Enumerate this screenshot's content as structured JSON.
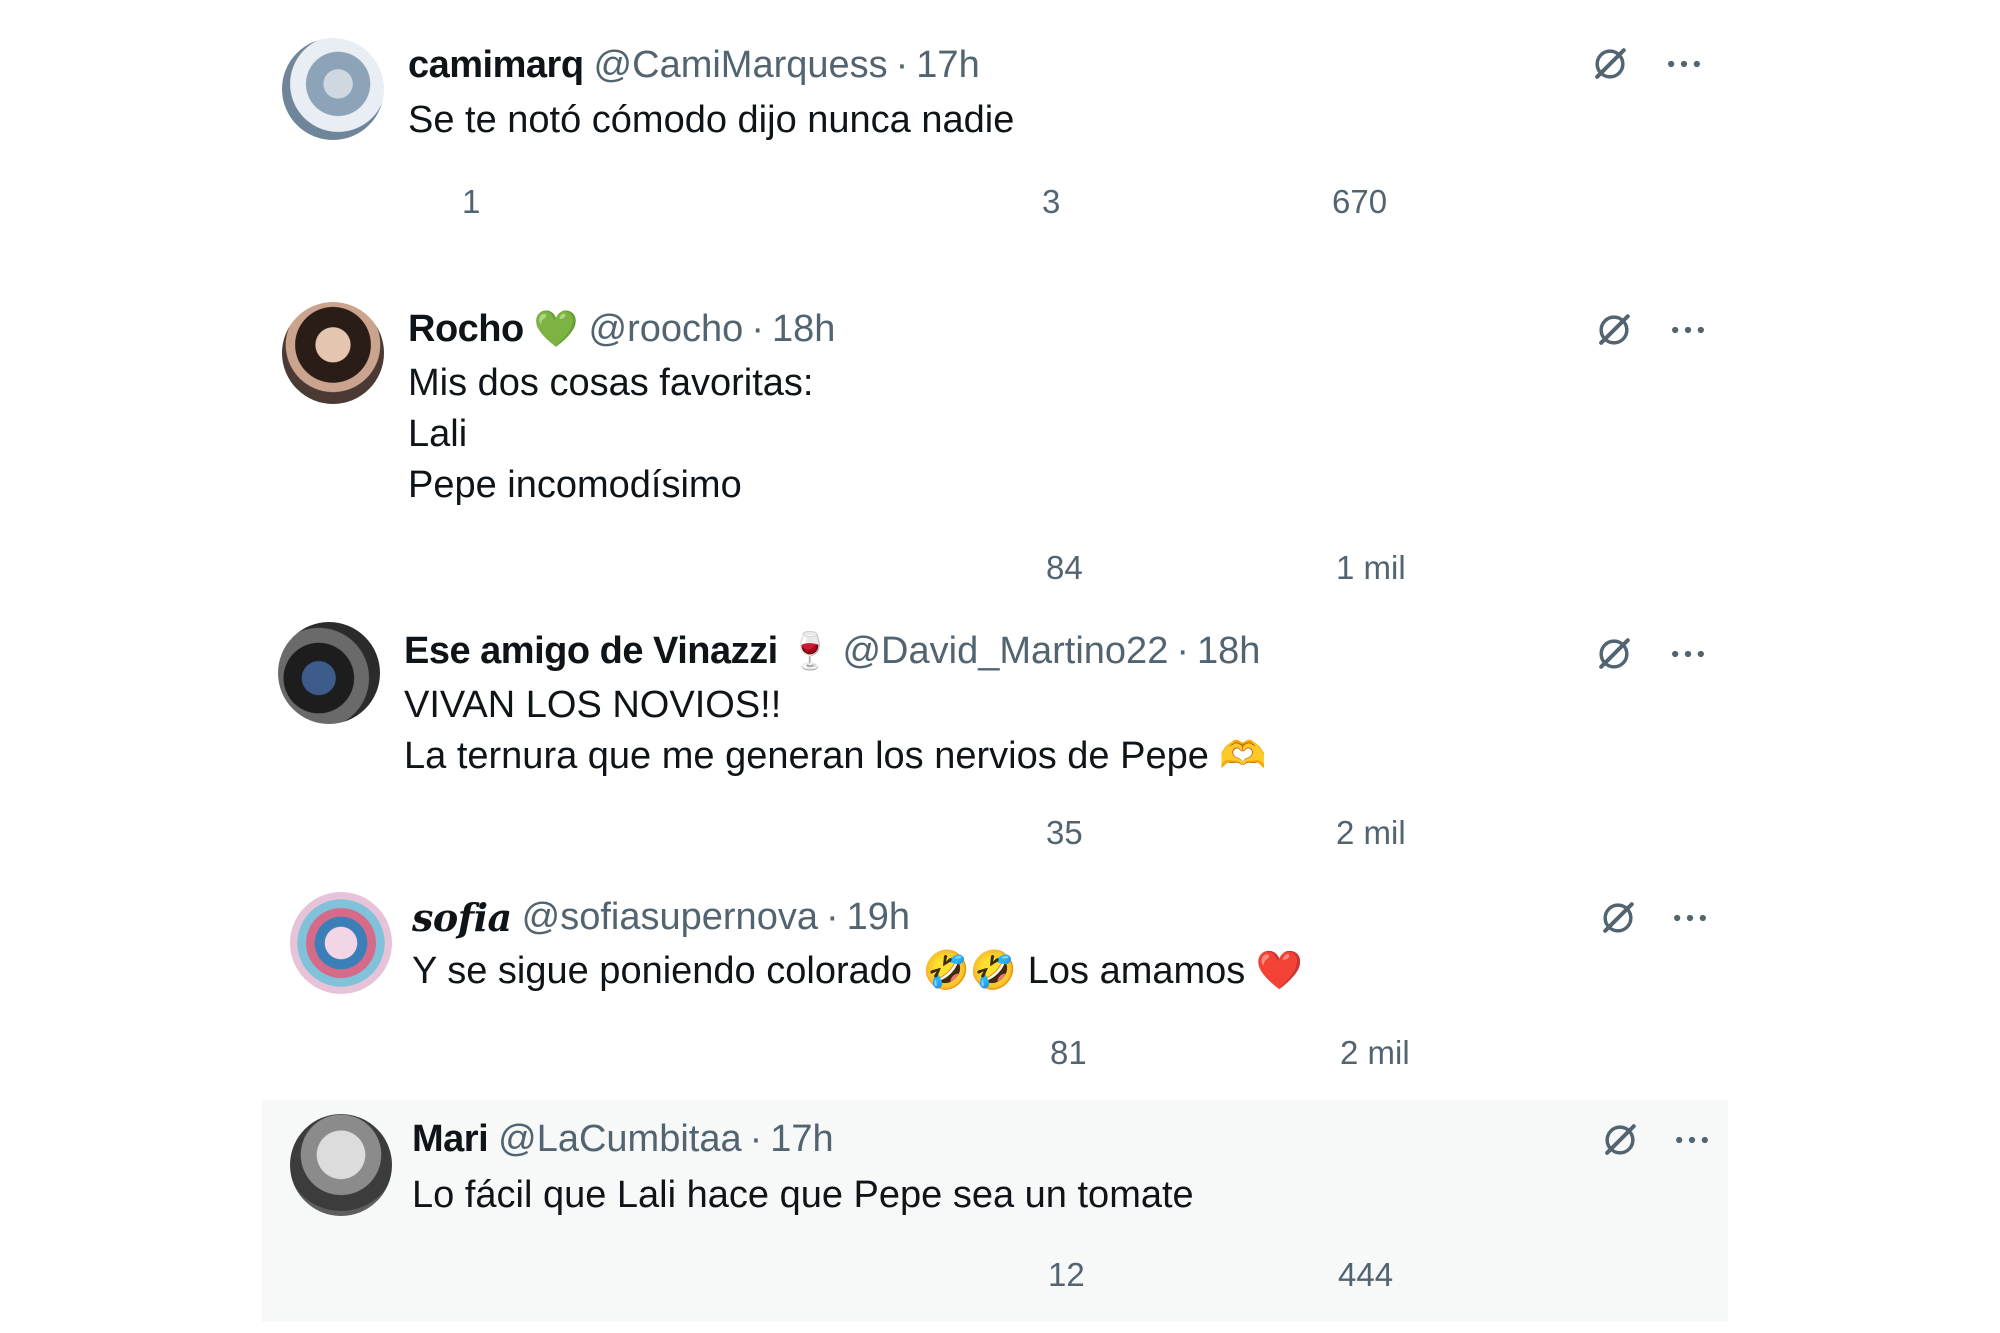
{
  "tweets": [
    {
      "name": "camimarq",
      "badge": "",
      "handle": "@CamiMarquess",
      "separator": "·",
      "time": "17h",
      "text": "Se te notó cómodo dijo nunca nadie",
      "replies": "1",
      "retweets": "",
      "likes": "3",
      "views": "670"
    },
    {
      "name": "Rocho",
      "badge": "💚",
      "handle": "@roocho",
      "separator": "·",
      "time": "18h",
      "text": "Mis dos cosas favoritas:\nLali\nPepe incomodísimo",
      "replies": "",
      "retweets": "",
      "likes": "84",
      "views": "1 mil"
    },
    {
      "name": "Ese amigo de Vinazzi",
      "badge": "🍷",
      "handle": "@David_Martino22",
      "separator": "·",
      "time": "18h",
      "text": "VIVAN LOS NOVIOS!!\nLa ternura que me generan los nervios de Pepe 🫶",
      "replies": "",
      "retweets": "",
      "likes": "35",
      "views": "2 mil"
    },
    {
      "name": "𝒔𝒐𝒇𝒊𝒂",
      "badge": "",
      "handle": "@sofiasupernova",
      "separator": "·",
      "time": "19h",
      "text": "Y se sigue poniendo colorado 🤣🤣 Los amamos ❤️",
      "replies": "",
      "retweets": "",
      "likes": "81",
      "views": "2 mil"
    },
    {
      "name": "Mari",
      "badge": "",
      "handle": "@LaCumbitaa",
      "separator": "·",
      "time": "17h",
      "text": "Lo fácil que Lali hace que Pepe sea un tomate",
      "replies": "",
      "retweets": "",
      "likes": "12",
      "views": "444"
    }
  ],
  "icons": {
    "reply": "reply-icon",
    "retweet": "retweet-icon",
    "like": "like-icon",
    "views": "views-icon",
    "bookmark": "bookmark-icon",
    "share": "share-icon",
    "grok": "grok-icon",
    "more": "more-icon"
  },
  "colors": {
    "text_primary": "#0f1419",
    "text_secondary": "#536471",
    "hover_background": "#f7f9f9"
  }
}
